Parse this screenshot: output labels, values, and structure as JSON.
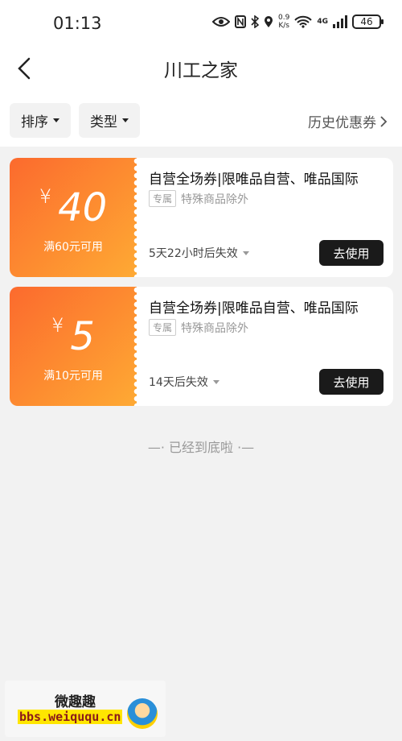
{
  "status_bar": {
    "time": "01:13",
    "speed_value": "0.9",
    "speed_unit": "K/s",
    "network": "4G",
    "battery": "46"
  },
  "nav": {
    "title": "川工之家"
  },
  "filters": {
    "sort_label": "排序",
    "type_label": "类型",
    "history_label": "历史优惠券"
  },
  "coupons": [
    {
      "currency": "¥",
      "amount": "40",
      "condition": "满60元可用",
      "name": "自营全场券|限唯品自营、唯品国际",
      "tag": "专属",
      "note": "特殊商品除外",
      "expiry": "5天22小时后失效",
      "action": "去使用"
    },
    {
      "currency": "¥",
      "amount": "5",
      "condition": "满10元可用",
      "name": "自营全场券|限唯品自营、唯品国际",
      "tag": "专属",
      "note": "特殊商品除外",
      "expiry": "14天后失效",
      "action": "去使用"
    }
  ],
  "footer": {
    "end_text": "—· 已经到底啦 ·—"
  },
  "watermark": {
    "title": "微趣趣",
    "url": "bbs.weiququ.cn"
  },
  "colors": {
    "coupon_gradient_start": "#fc6a2e",
    "coupon_gradient_end": "#feaa34",
    "button_bg": "#1a1a1a"
  }
}
